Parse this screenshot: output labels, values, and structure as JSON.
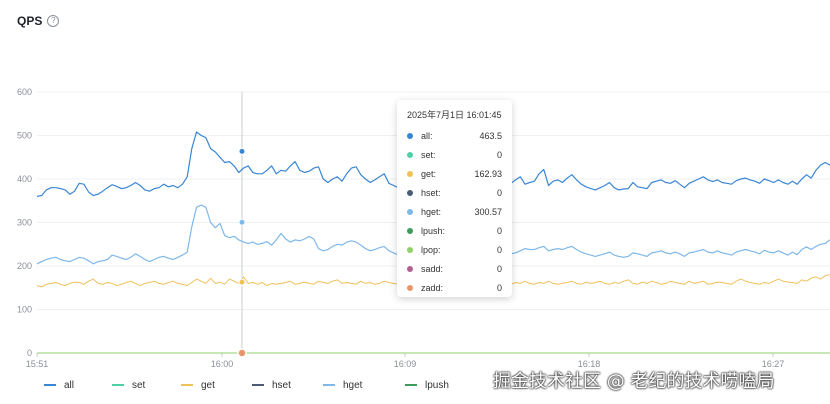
{
  "panel": {
    "title": "QPS",
    "help_icon": "help-circle-icon"
  },
  "tooltip": {
    "header": "2025年7月1日 16:01:45",
    "rows": [
      {
        "name": "all:",
        "value": "463.5",
        "color": "#3a86d4"
      },
      {
        "name": "set:",
        "value": "0",
        "color": "#4fd1a5"
      },
      {
        "name": "get:",
        "value": "162.93",
        "color": "#f0c05a"
      },
      {
        "name": "hset:",
        "value": "0",
        "color": "#4a5b73"
      },
      {
        "name": "hget:",
        "value": "300.57",
        "color": "#7fb8ea"
      },
      {
        "name": "lpush:",
        "value": "0",
        "color": "#3f9a5e"
      },
      {
        "name": "lpop:",
        "value": "0",
        "color": "#8fd16a"
      },
      {
        "name": "sadd:",
        "value": "0",
        "color": "#b0608f"
      },
      {
        "name": "zadd:",
        "value": "0",
        "color": "#e8956a"
      }
    ]
  },
  "watermark": "掘金技术社区 @ 老纪的技术唠嗑局",
  "chart_data": {
    "type": "line",
    "title": "QPS",
    "xlabel": "",
    "ylabel": "",
    "ylim": [
      0,
      600
    ],
    "yticks": [
      "0",
      "100",
      "200",
      "300",
      "400",
      "500",
      "600"
    ],
    "xticks": [
      "15:51",
      "16:00",
      "16:09",
      "16:18",
      "16:27"
    ],
    "grid": true,
    "legend_position": "bottom",
    "hover_x_label": "16:01:45",
    "series": [
      {
        "name": "all",
        "color": "#3a86d4",
        "values": [
          360,
          362,
          375,
          380,
          380,
          378,
          375,
          365,
          372,
          390,
          388,
          370,
          362,
          365,
          372,
          380,
          387,
          383,
          378,
          380,
          385,
          392,
          385,
          375,
          372,
          378,
          380,
          388,
          382,
          385,
          380,
          388,
          405,
          470,
          508,
          500,
          495,
          470,
          462,
          450,
          438,
          440,
          430,
          415,
          425,
          430,
          415,
          412,
          412,
          420,
          430,
          412,
          420,
          418,
          430,
          440,
          420,
          415,
          418,
          425,
          428,
          400,
          392,
          400,
          405,
          395,
          412,
          425,
          428,
          410,
          400,
          392,
          398,
          405,
          412,
          390,
          385,
          380,
          385,
          378,
          390,
          395,
          402,
          410,
          400,
          390,
          390,
          375,
          372,
          378,
          380,
          392,
          398,
          400,
          395,
          402,
          392,
          388,
          380,
          385,
          395,
          390,
          398,
          405,
          388,
          392,
          395,
          412,
          422,
          385,
          395,
          398,
          392,
          402,
          410,
          398,
          388,
          382,
          378,
          375,
          380,
          385,
          392,
          380,
          375,
          377,
          378,
          392,
          382,
          380,
          378,
          392,
          395,
          398,
          392,
          390,
          396,
          388,
          380,
          390,
          395,
          400,
          405,
          398,
          394,
          398,
          392,
          390,
          388,
          396,
          400,
          402,
          398,
          395,
          390,
          400,
          396,
          392,
          398,
          392,
          388,
          395,
          388,
          400,
          410,
          402,
          420,
          432,
          438,
          432
        ]
      },
      {
        "name": "set",
        "color": "#4fd1a5",
        "values": [
          0,
          0,
          0,
          0,
          0,
          0,
          0,
          0,
          0,
          0
        ]
      },
      {
        "name": "get",
        "color": "#f0c05a",
        "values": [
          155,
          152,
          158,
          160,
          162,
          158,
          155,
          160,
          163,
          162,
          158,
          165,
          170,
          160,
          158,
          162,
          160,
          155,
          158,
          162,
          165,
          160,
          155,
          160,
          162,
          165,
          160,
          158,
          162,
          165,
          160,
          158,
          155,
          162,
          170,
          165,
          160,
          172,
          160,
          163,
          158,
          170,
          165,
          160,
          175,
          160,
          162,
          158,
          162,
          155,
          160,
          158,
          160,
          162,
          165,
          158,
          160,
          163,
          160,
          158,
          165,
          162,
          160,
          165,
          168,
          160,
          162,
          160,
          158,
          165,
          160,
          162,
          158,
          160,
          165,
          162,
          160,
          158,
          162,
          160,
          165,
          160,
          158,
          155,
          160,
          163,
          165,
          160,
          158,
          162,
          160,
          165,
          160,
          158,
          162,
          160,
          165,
          170,
          165,
          162,
          160,
          158,
          162,
          160,
          165,
          160,
          158,
          162,
          160,
          165,
          160,
          158,
          160,
          162,
          165,
          160,
          158,
          163,
          160,
          162,
          165,
          160,
          158,
          162,
          160,
          165,
          168,
          160,
          158,
          163,
          160,
          165,
          162,
          158,
          160,
          165,
          162,
          160,
          158,
          165,
          160,
          162,
          165,
          158,
          160,
          163,
          162,
          160,
          158,
          165,
          170,
          165,
          162,
          160,
          158,
          162,
          160,
          165,
          170,
          165,
          163,
          162,
          160,
          168,
          165,
          172,
          175,
          170,
          178,
          180
        ]
      },
      {
        "name": "hget",
        "color": "#7fb8ea",
        "values": [
          205,
          210,
          215,
          218,
          220,
          215,
          212,
          210,
          215,
          220,
          218,
          212,
          205,
          210,
          212,
          215,
          225,
          222,
          218,
          215,
          220,
          228,
          222,
          215,
          210,
          215,
          220,
          222,
          218,
          215,
          220,
          225,
          232,
          290,
          335,
          340,
          335,
          300,
          288,
          298,
          270,
          265,
          268,
          260,
          255,
          252,
          255,
          250,
          252,
          256,
          248,
          260,
          275,
          262,
          255,
          260,
          258,
          262,
          268,
          262,
          240,
          235,
          238,
          245,
          250,
          248,
          255,
          258,
          255,
          248,
          240,
          235,
          238,
          242,
          245,
          235,
          230,
          225,
          228,
          222,
          225,
          230,
          235,
          228,
          225,
          230,
          226,
          218,
          222,
          225,
          215,
          222,
          230,
          232,
          225,
          228,
          232,
          235,
          232,
          230,
          225,
          228,
          230,
          235,
          240,
          238,
          238,
          242,
          245,
          235,
          238,
          240,
          238,
          242,
          245,
          238,
          232,
          228,
          225,
          222,
          225,
          228,
          232,
          225,
          222,
          220,
          222,
          230,
          228,
          225,
          222,
          230,
          232,
          235,
          230,
          228,
          232,
          228,
          222,
          230,
          232,
          235,
          238,
          232,
          230,
          235,
          230,
          228,
          225,
          232,
          235,
          238,
          235,
          232,
          228,
          236,
          232,
          230,
          235,
          230,
          225,
          232,
          226,
          238,
          244,
          238,
          245,
          250,
          252,
          260
        ]
      },
      {
        "name": "hset",
        "color": "#4a5b73",
        "values": [
          0,
          0,
          0,
          0,
          0,
          0,
          0,
          0,
          0,
          0
        ]
      },
      {
        "name": "lpush",
        "color": "#3f9a5e",
        "values": [
          0,
          0,
          0,
          0,
          0,
          0,
          0,
          0,
          0,
          0
        ]
      },
      {
        "name": "lpop",
        "color": "#8fd16a",
        "values": [
          0,
          0,
          0,
          0,
          0,
          0,
          0,
          0,
          0,
          0
        ]
      }
    ],
    "legend": [
      "all",
      "set",
      "get",
      "hset",
      "hget",
      "lpush"
    ]
  }
}
